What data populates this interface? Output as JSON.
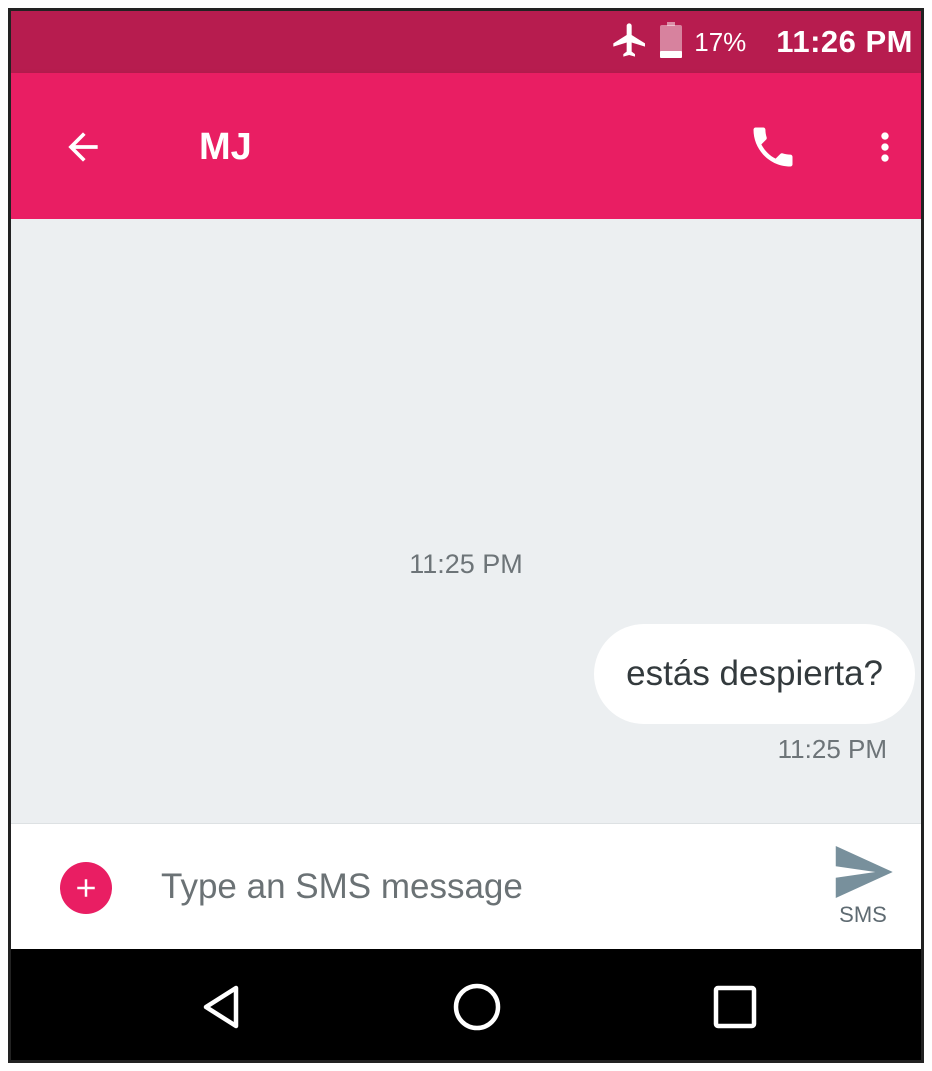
{
  "status_bar": {
    "battery_percent": "17%",
    "time": "11:26 PM",
    "icons": [
      "airplane-mode-icon",
      "battery-icon"
    ]
  },
  "app_bar": {
    "contact_name": "MJ",
    "icons": [
      "back-arrow-icon",
      "phone-icon",
      "more-vert-icon"
    ]
  },
  "conversation": {
    "date_divider": "11:25 PM",
    "messages": [
      {
        "text": "estás despierta?",
        "time": "11:25 PM"
      }
    ]
  },
  "compose": {
    "placeholder": "Type an SMS message",
    "value": "",
    "send_label": "SMS",
    "icons": [
      "add-attachment-icon",
      "send-icon"
    ]
  },
  "nav_bar": {
    "icons": [
      "nav-back-icon",
      "nav-home-icon",
      "nav-recents-icon"
    ]
  },
  "colors": {
    "status_bar": "#b71c4f",
    "app_bar": "#e91e63",
    "accent": "#e91e63",
    "conversation_bg": "#eceff1",
    "bubble_bg": "#ffffff",
    "send_icon": "#78909c"
  }
}
